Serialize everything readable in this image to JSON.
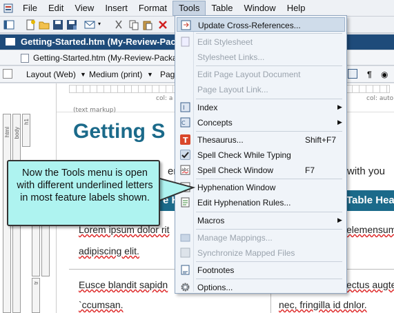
{
  "menubar": {
    "items": [
      "File",
      "Edit",
      "View",
      "Insert",
      "Format",
      "Tools",
      "Table",
      "Window",
      "Help"
    ],
    "active": "Tools"
  },
  "document": {
    "tab_title": "Getting-Started.htm (My-Review-Package)",
    "subtab_title": "Getting-Started.htm (My-Review-Packa",
    "layout_label": "Layout (Web)",
    "medium_label": "Medium (print)",
    "page_label": "Pag",
    "col_label_1": "col: a",
    "col_label_2": "col: auto",
    "markup_label": "(text markup)",
    "structure_tags": [
      "html",
      "body",
      "h1",
      "tr",
      "td"
    ],
    "heading": "Getting S",
    "intro_left": "enera",
    "intro_right": "with you",
    "table_head_left": "e H",
    "table_head_right": "Table Hea",
    "row1_left": "Lorem ipsum dolor rit",
    "row1_right": "elemensum",
    "row1_line2": "adipiscing elit.",
    "row2_left": "Eusce blandit sapidn",
    "row2_right": "ectus augte",
    "row2_line2_left": "`ccumsan.",
    "row2_line2_right": "nec, fringilla id dnlor."
  },
  "tools_menu": {
    "items": [
      {
        "label": "Update Cross-References...",
        "icon": "update-xref-icon",
        "enabled": true,
        "highlighted": true
      },
      {
        "label": "Edit Stylesheet",
        "icon": "stylesheet-icon",
        "enabled": false
      },
      {
        "label": "Stylesheet Links...",
        "icon": "",
        "enabled": false
      },
      {
        "label": "Edit Page Layout Document",
        "icon": "",
        "enabled": false
      },
      {
        "label": "Page Layout Link...",
        "icon": "",
        "enabled": false
      },
      {
        "label": "Index",
        "icon": "index-icon",
        "enabled": true,
        "submenu": true
      },
      {
        "label": "Concepts",
        "icon": "concepts-icon",
        "enabled": true,
        "submenu": true
      },
      {
        "label": "Thesaurus...",
        "icon": "thesaurus-icon",
        "enabled": true,
        "shortcut": "Shift+F7"
      },
      {
        "label": "Spell Check While Typing",
        "icon": "checkmark-icon",
        "enabled": true,
        "checked": true
      },
      {
        "label": "Spell Check Window",
        "icon": "spellcheck-icon",
        "enabled": true,
        "shortcut": "F7"
      },
      {
        "label": "Hyphenation Window",
        "icon": "hyphenation-icon",
        "enabled": true
      },
      {
        "label": "Edit Hyphenation Rules...",
        "icon": "hyphenation-rules-icon",
        "enabled": true
      },
      {
        "label": "Macros",
        "icon": "",
        "enabled": true,
        "submenu": true
      },
      {
        "label": "Manage Mappings...",
        "icon": "mappings-icon",
        "enabled": false
      },
      {
        "label": "Synchronize Mapped Files",
        "icon": "sync-icon",
        "enabled": false
      },
      {
        "label": "Footnotes",
        "icon": "footnotes-icon",
        "enabled": true
      },
      {
        "label": "Options...",
        "icon": "gear-icon",
        "enabled": true
      }
    ]
  },
  "callout": {
    "text": "Now the Tools menu is open with different underlined letters in most feature labels shown."
  },
  "colors": {
    "doc_tab_bg": "#1e4b7a",
    "heading": "#1b6a8a",
    "callout_bg": "#aef3f0",
    "menu_bg": "#f0f4f9",
    "highlight": "#cfdcea"
  }
}
